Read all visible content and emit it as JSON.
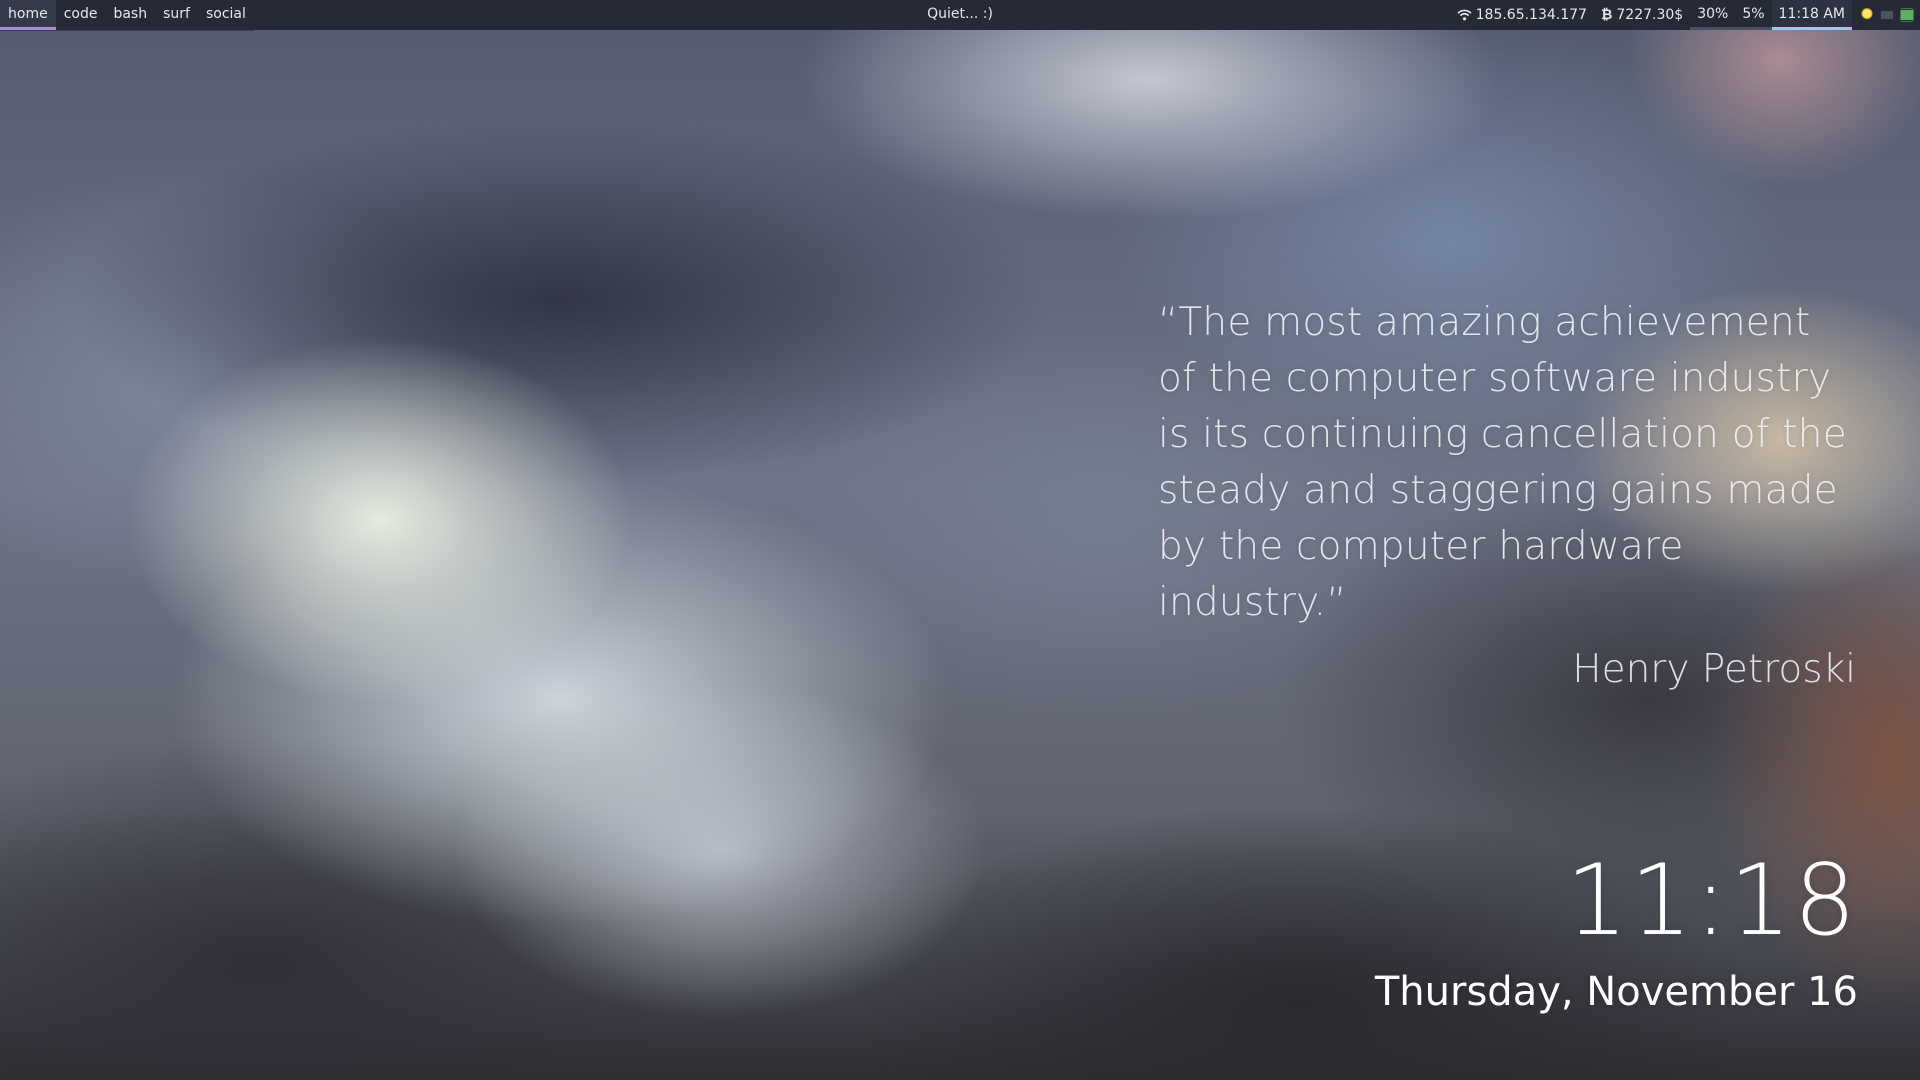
{
  "topbar": {
    "workspaces": [
      {
        "label": "home",
        "active": true
      },
      {
        "label": "code",
        "active": false
      },
      {
        "label": "bash",
        "active": false
      },
      {
        "label": "surf",
        "active": false
      },
      {
        "label": "social",
        "active": false
      }
    ],
    "title": "Quiet... :)",
    "status": {
      "ip": "185.65.134.177",
      "btc": "7227.30$",
      "volume": "30%",
      "cpu": "5%",
      "time": "11:18 AM"
    },
    "tray_icons": [
      "lightbulb-icon",
      "keyboard-icon",
      "network-icon"
    ],
    "colors": {
      "bar_bg": "#262a36",
      "active_workspace_underline": "#a78bdb",
      "clock_underline": "#7fd4f0"
    }
  },
  "quote": {
    "text": "“The most amazing achievement of the computer software industry is its continuing cancellation of the steady and staggering gains made by the computer hardware industry.”",
    "author": "Henry Petroski"
  },
  "desktop_clock": {
    "time": "11:18",
    "date": "Thursday, November 16"
  }
}
